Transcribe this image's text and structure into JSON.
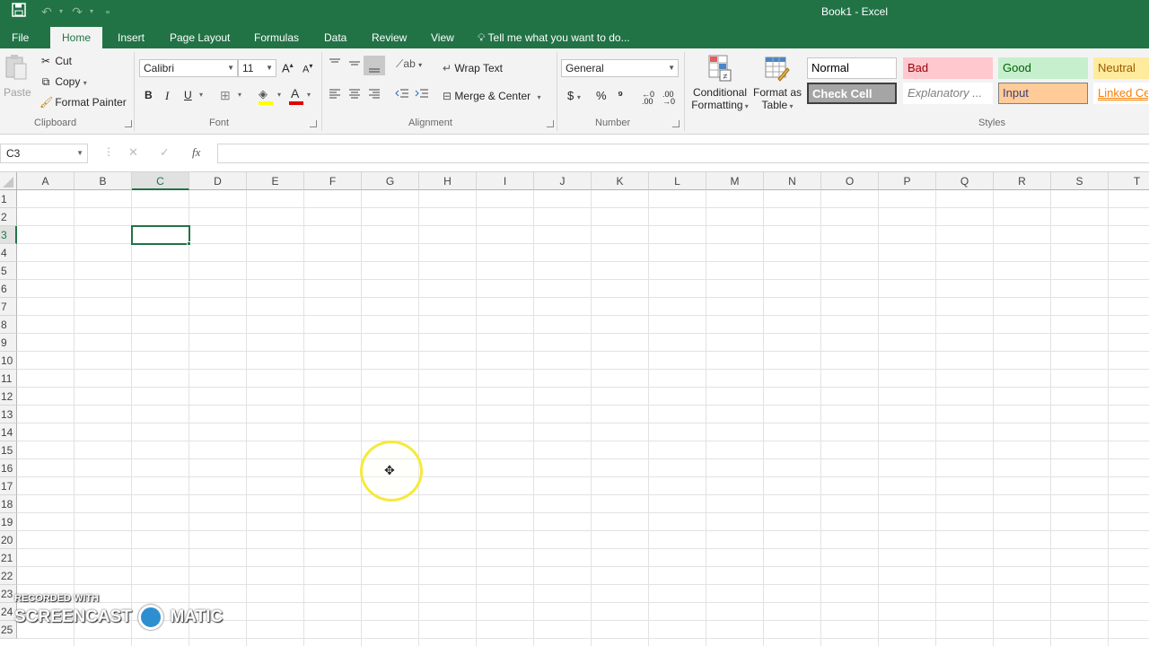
{
  "window": {
    "title": "Book1 - Excel",
    "quick_access": {
      "save_icon": "save-icon",
      "undo_icon": "undo-icon",
      "redo_icon": "redo-icon",
      "customize_icon": "customize-qat-icon"
    }
  },
  "tabs": [
    "File",
    "Home",
    "Insert",
    "Page Layout",
    "Formulas",
    "Data",
    "Review",
    "View"
  ],
  "active_tab": "Home",
  "tell_me": "Tell me what you want to do...",
  "ribbon": {
    "clipboard": {
      "label": "Clipboard",
      "paste": "Paste",
      "cut": "Cut",
      "copy": "Copy",
      "format_painter": "Format Painter"
    },
    "font": {
      "label": "Font",
      "font_name": "Calibri",
      "font_size": "11",
      "bold": "B",
      "italic": "I",
      "underline": "U",
      "font_color_glyph": "A"
    },
    "alignment": {
      "label": "Alignment",
      "wrap_text": "Wrap Text",
      "merge_center": "Merge & Center"
    },
    "number": {
      "label": "Number",
      "format": "General",
      "currency": "$",
      "percent": "%",
      "comma": "⁹"
    },
    "conditional_formatting": {
      "line1": "Conditional",
      "line2": "Formatting"
    },
    "format_as_table": {
      "line1": "Format as",
      "line2": "Table"
    },
    "styles": {
      "label": "Styles",
      "items": [
        {
          "name": "Normal",
          "bg": "#ffffff",
          "fg": "#000000"
        },
        {
          "name": "Bad",
          "bg": "#ffc7ce",
          "fg": "#9c0006"
        },
        {
          "name": "Good",
          "bg": "#c6efce",
          "fg": "#006100"
        },
        {
          "name": "Neutral",
          "bg": "#ffeb9c",
          "fg": "#9c5700"
        },
        {
          "name": "Check Cell",
          "bg": "#a5a5a5",
          "fg": "#ffffff"
        },
        {
          "name": "Explanatory ...",
          "bg": "#ffffff",
          "fg": "#7f7f7f"
        },
        {
          "name": "Input",
          "bg": "#ffcc99",
          "fg": "#3f3f76"
        },
        {
          "name": "Linked Ce",
          "bg": "#ffffff",
          "fg": "#fa7d00"
        }
      ]
    }
  },
  "formula_bar": {
    "name_box": "C3",
    "cancel": "✕",
    "enter": "✓",
    "fx": "fx",
    "content": ""
  },
  "sheet": {
    "columns": [
      "A",
      "B",
      "C",
      "D",
      "E",
      "F",
      "G",
      "H",
      "I",
      "J",
      "K",
      "L",
      "M",
      "N",
      "O",
      "P",
      "Q",
      "R",
      "S",
      "T"
    ],
    "rows": [
      "1",
      "2",
      "3",
      "4",
      "5",
      "6",
      "7",
      "8",
      "9",
      "10",
      "11",
      "12",
      "13",
      "14",
      "15",
      "16",
      "17",
      "18",
      "19",
      "20",
      "21",
      "22",
      "23",
      "24",
      "25"
    ],
    "active_cell": "C3"
  },
  "watermark": {
    "line1": "RECORDED WITH",
    "line2a": "SCREENCAST",
    "line2b": "MATIC"
  },
  "colors": {
    "accent": "#217346",
    "ribbon_bg": "#f3f3f3",
    "cursor_highlight": "#f5ea3a"
  }
}
